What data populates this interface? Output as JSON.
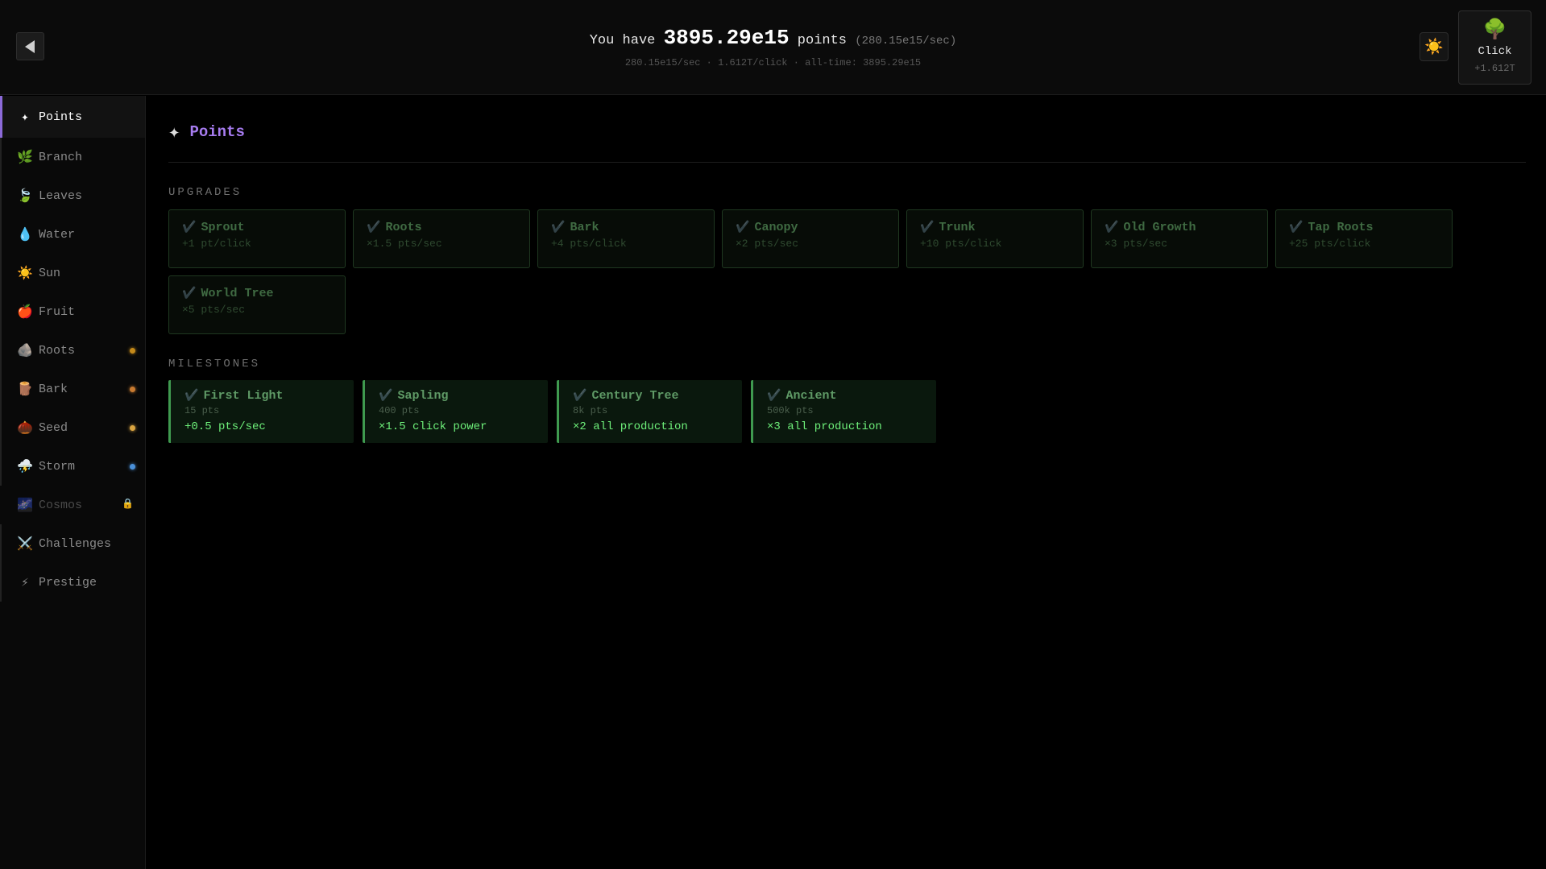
{
  "header": {
    "points_prefix": "You have",
    "points_value": "3895.29e15",
    "points_suffix": "points",
    "points_rate": "(280.15e15/sec)",
    "sub_stats": "280.15e15/sec · 1.612T/click · all-time: 3895.29e15",
    "theme_icon": "☀️",
    "click_icon": "🌳",
    "click_label": "Click",
    "click_value": "+1.612T"
  },
  "sidebar": {
    "items": [
      {
        "icon": "✦",
        "label": "Points",
        "state": "active"
      },
      {
        "icon": "🌿",
        "label": "Branch"
      },
      {
        "icon": "🍃",
        "label": "Leaves"
      },
      {
        "icon": "💧",
        "label": "Water"
      },
      {
        "icon": "☀️",
        "label": "Sun"
      },
      {
        "icon": "🍎",
        "label": "Fruit"
      },
      {
        "icon": "🪨",
        "label": "Roots",
        "dot_color": "#c48a1a"
      },
      {
        "icon": "🪵",
        "label": "Bark",
        "dot_color": "#c87a30"
      },
      {
        "icon": "🌰",
        "label": "Seed",
        "dot_color": "#d9a441"
      },
      {
        "icon": "⛈️",
        "label": "Storm",
        "dot_color": "#4a90d9"
      },
      {
        "icon": "🌌",
        "label": "Cosmos",
        "state": "locked",
        "lock_icon": "🔒"
      },
      {
        "icon": "⚔️",
        "label": "Challenges"
      },
      {
        "icon": "⚡",
        "label": "Prestige"
      }
    ]
  },
  "main": {
    "title_icon": "✦",
    "title": "Points",
    "upgrades_label": "UPGRADES",
    "check_icon": "✔️",
    "upgrades": [
      {
        "name": "Sprout",
        "desc": "+1 pt/click"
      },
      {
        "name": "Roots",
        "desc": "×1.5 pts/sec"
      },
      {
        "name": "Bark",
        "desc": "+4 pts/click"
      },
      {
        "name": "Canopy",
        "desc": "×2 pts/sec"
      },
      {
        "name": "Trunk",
        "desc": "+10 pts/click"
      },
      {
        "name": "Old Growth",
        "desc": "×3 pts/sec"
      },
      {
        "name": "Tap Roots",
        "desc": "+25 pts/click"
      },
      {
        "name": "World Tree",
        "desc": "×5 pts/sec"
      }
    ],
    "milestones_label": "MILESTONES",
    "milestones": [
      {
        "name": "First Light",
        "cost": "15 pts",
        "effect": "+0.5 pts/sec"
      },
      {
        "name": "Sapling",
        "cost": "400 pts",
        "effect": "×1.5 click power"
      },
      {
        "name": "Century Tree",
        "cost": "8k pts",
        "effect": "×2 all production"
      },
      {
        "name": "Ancient",
        "cost": "500k pts",
        "effect": "×3 all production"
      }
    ]
  }
}
